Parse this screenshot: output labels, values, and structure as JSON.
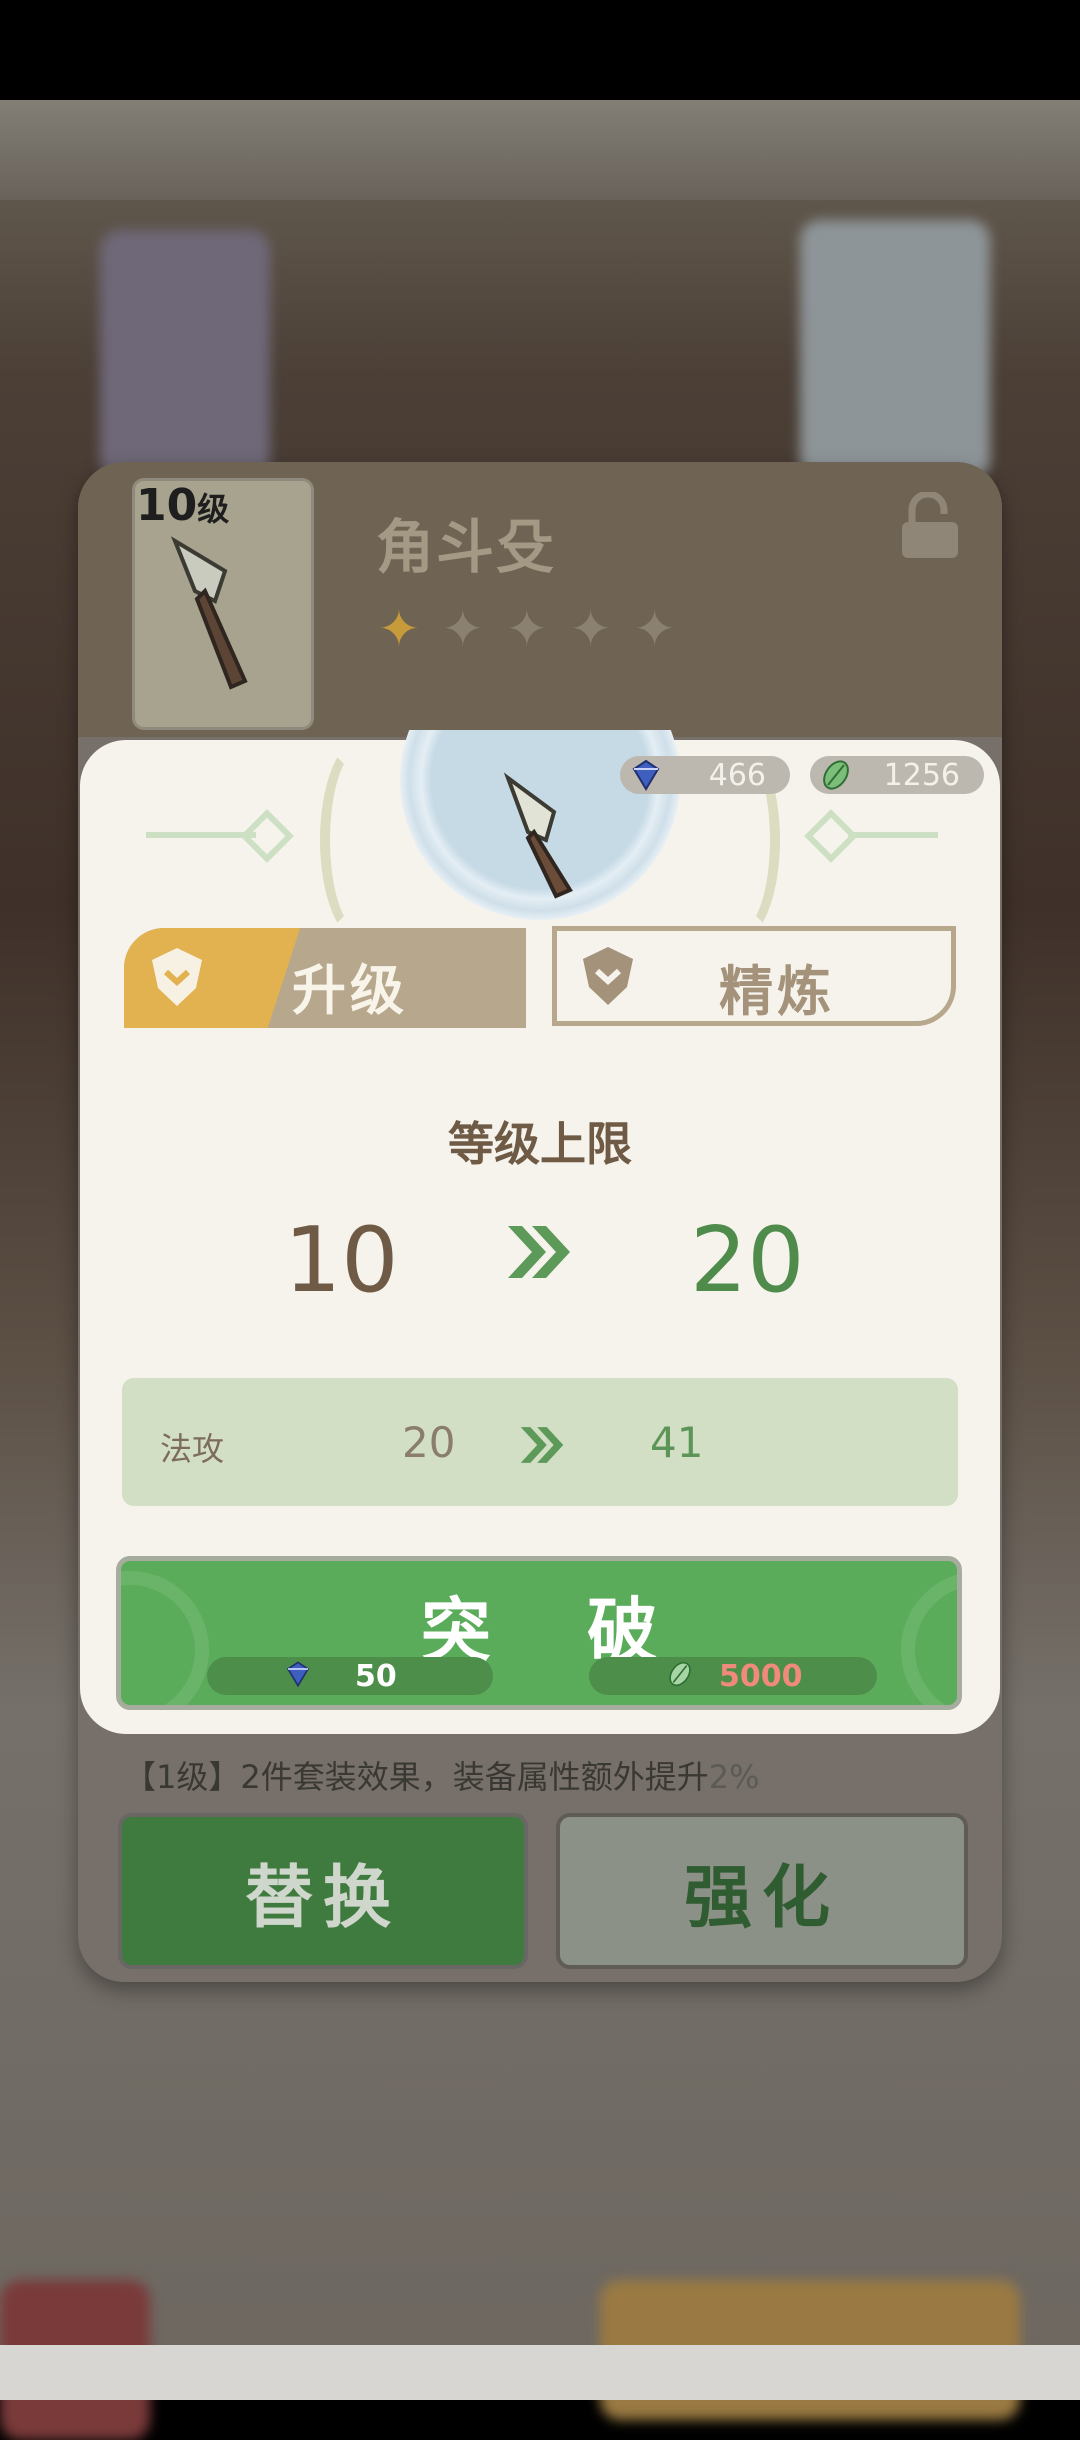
{
  "item": {
    "level": "10",
    "level_unit": "级",
    "name": "角斗殳",
    "stars_total": 5,
    "stars_filled": 1
  },
  "currency": {
    "gems": "466",
    "leaves": "1256"
  },
  "tabs": {
    "upgrade": "升级",
    "refine": "精炼",
    "active": "upgrade"
  },
  "level_cap": {
    "title": "等级上限",
    "from": "10",
    "to": "20"
  },
  "stat": {
    "name": "法攻",
    "from": "20",
    "to": "41"
  },
  "breakthrough": {
    "label": "突 破",
    "gem_cost": "50",
    "leaf_cost": "5000"
  },
  "set_bonus": {
    "text": "【1级】2件套装效果，装备属性额外提升",
    "pct": "2%"
  },
  "actions": {
    "replace": "替换",
    "strengthen": "强化"
  },
  "colors": {
    "accent_green": "#5aac5a",
    "gold": "#e2b150",
    "cost_red": "#f08a7a"
  }
}
